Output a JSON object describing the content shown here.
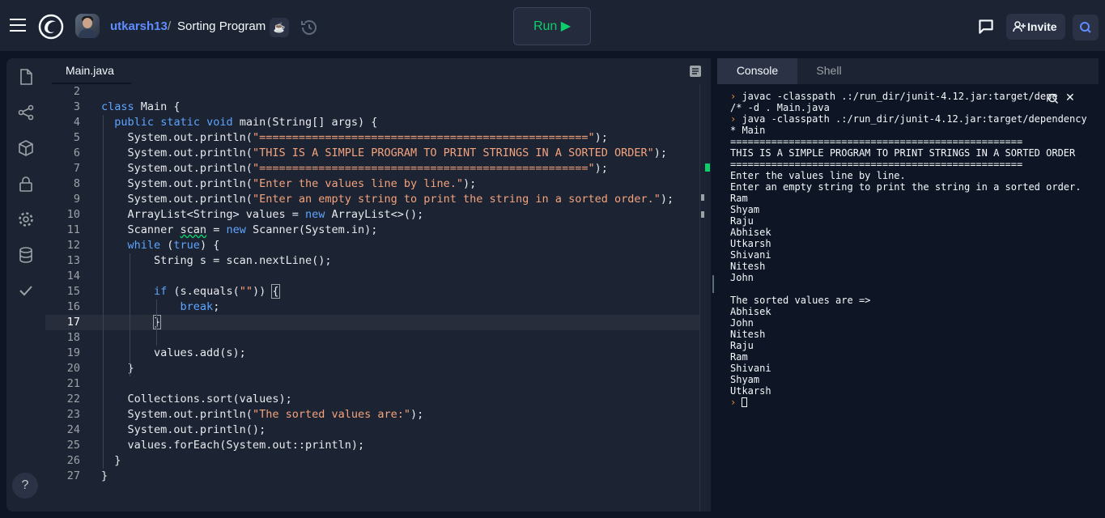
{
  "header": {
    "username": "utkarsh13",
    "separator": "/",
    "repl_name": "Sorting Program",
    "language_icon": "java-cup-icon",
    "run_label": "Run ▶",
    "invite_label": "Invite"
  },
  "sidebar": {
    "items": [
      "files-icon",
      "git-icon",
      "packages-icon",
      "secrets-icon",
      "settings-icon",
      "database-icon",
      "check-icon"
    ],
    "help_label": "?"
  },
  "editor": {
    "tab_label": "Main.java",
    "active_line": "17",
    "line_numbers": [
      "2",
      "3",
      "4",
      "5",
      "6",
      "7",
      "8",
      "9",
      "10",
      "11",
      "12",
      "13",
      "14",
      "15",
      "16",
      "17",
      "18",
      "19",
      "20",
      "21",
      "22",
      "23",
      "24",
      "25",
      "26",
      "27"
    ]
  },
  "console": {
    "tabs": [
      "Console",
      "Shell"
    ],
    "output": [
      {
        "prompt": true,
        "text": "javac -classpath .:/run_dir/junit-4.12.jar:target/depe"
      },
      {
        "prompt": false,
        "text": "/* -d . Main.java"
      },
      {
        "prompt": true,
        "text": "java -classpath .:/run_dir/junit-4.12.jar:target/dependency/"
      },
      {
        "prompt": false,
        "text": "* Main"
      },
      {
        "prompt": false,
        "text": "=================================================="
      },
      {
        "prompt": false,
        "text": "THIS IS A SIMPLE PROGRAM TO PRINT STRINGS IN A SORTED ORDER"
      },
      {
        "prompt": false,
        "text": "=================================================="
      },
      {
        "prompt": false,
        "text": "Enter the values line by line."
      },
      {
        "prompt": false,
        "text": "Enter an empty string to print the string in a sorted order."
      },
      {
        "prompt": false,
        "text": "Ram"
      },
      {
        "prompt": false,
        "text": "Shyam"
      },
      {
        "prompt": false,
        "text": "Raju"
      },
      {
        "prompt": false,
        "text": "Abhisek"
      },
      {
        "prompt": false,
        "text": "Utkarsh"
      },
      {
        "prompt": false,
        "text": "Shivani"
      },
      {
        "prompt": false,
        "text": "Nitesh"
      },
      {
        "prompt": false,
        "text": "John"
      },
      {
        "prompt": false,
        "text": ""
      },
      {
        "prompt": false,
        "text": "The sorted values are =>"
      },
      {
        "prompt": false,
        "text": "Abhisek"
      },
      {
        "prompt": false,
        "text": "John"
      },
      {
        "prompt": false,
        "text": "Nitesh"
      },
      {
        "prompt": false,
        "text": "Raju"
      },
      {
        "prompt": false,
        "text": "Ram"
      },
      {
        "prompt": false,
        "text": "Shivani"
      },
      {
        "prompt": false,
        "text": "Shyam"
      },
      {
        "prompt": false,
        "text": "Utkarsh"
      }
    ]
  },
  "code": [
    {
      "n": "2",
      "t": ""
    },
    {
      "n": "3",
      "t": "<span class=\"kw\">class</span> Main {"
    },
    {
      "n": "4",
      "t": "  <span class=\"kw\">public</span> <span class=\"kw\">static</span> <span class=\"kw\">void</span> main(String[] args) {"
    },
    {
      "n": "5",
      "t": "    System.out.println(<span class=\"str\">\"==================================================\"</span>);"
    },
    {
      "n": "6",
      "t": "    System.out.println(<span class=\"str\">\"THIS IS A SIMPLE PROGRAM TO PRINT STRINGS IN A SORTED ORDER\"</span>);"
    },
    {
      "n": "7",
      "t": "    System.out.println(<span class=\"str\">\"==================================================\"</span>);"
    },
    {
      "n": "8",
      "t": "    System.out.println(<span class=\"str\">\"Enter the values line by line.\"</span>);"
    },
    {
      "n": "9",
      "t": "    System.out.println(<span class=\"str\">\"Enter an empty string to print the string in a sorted order.\"</span>);"
    },
    {
      "n": "10",
      "t": "    ArrayList&lt;String&gt; values = <span class=\"kw\">new</span> ArrayList&lt;&gt;();"
    },
    {
      "n": "11",
      "t": "    Scanner <span style=\"text-decoration: underline wavy #0cce6b;\">scan</span> = <span class=\"kw\">new</span> Scanner(System.in);"
    },
    {
      "n": "12",
      "t": "    <span class=\"kw\">while</span> (<span class=\"kw\">true</span>) {"
    },
    {
      "n": "13",
      "t": "        String s = scan.nextLine();"
    },
    {
      "n": "14",
      "t": ""
    },
    {
      "n": "15",
      "t": "        <span class=\"kw\">if</span> (s.equals(<span class=\"str\">\"\"</span>)) <span style=\"outline:1px solid #9da2a6;\">{</span>"
    },
    {
      "n": "16",
      "t": "            <span class=\"kw\">break</span>;"
    },
    {
      "n": "17",
      "t": "        <span style=\"outline:1px solid #9da2a6;\">}</span>"
    },
    {
      "n": "18",
      "t": ""
    },
    {
      "n": "19",
      "t": "        values.add(s);"
    },
    {
      "n": "20",
      "t": "    }"
    },
    {
      "n": "21",
      "t": ""
    },
    {
      "n": "22",
      "t": "    Collections.sort(values);"
    },
    {
      "n": "23",
      "t": "    System.out.println(<span class=\"str\">\"The sorted values are:\"</span>);"
    },
    {
      "n": "24",
      "t": "    System.out.println();"
    },
    {
      "n": "25",
      "t": "    values.forEach(System.out::println);"
    },
    {
      "n": "26",
      "t": "  }"
    },
    {
      "n": "27",
      "t": "}"
    }
  ]
}
